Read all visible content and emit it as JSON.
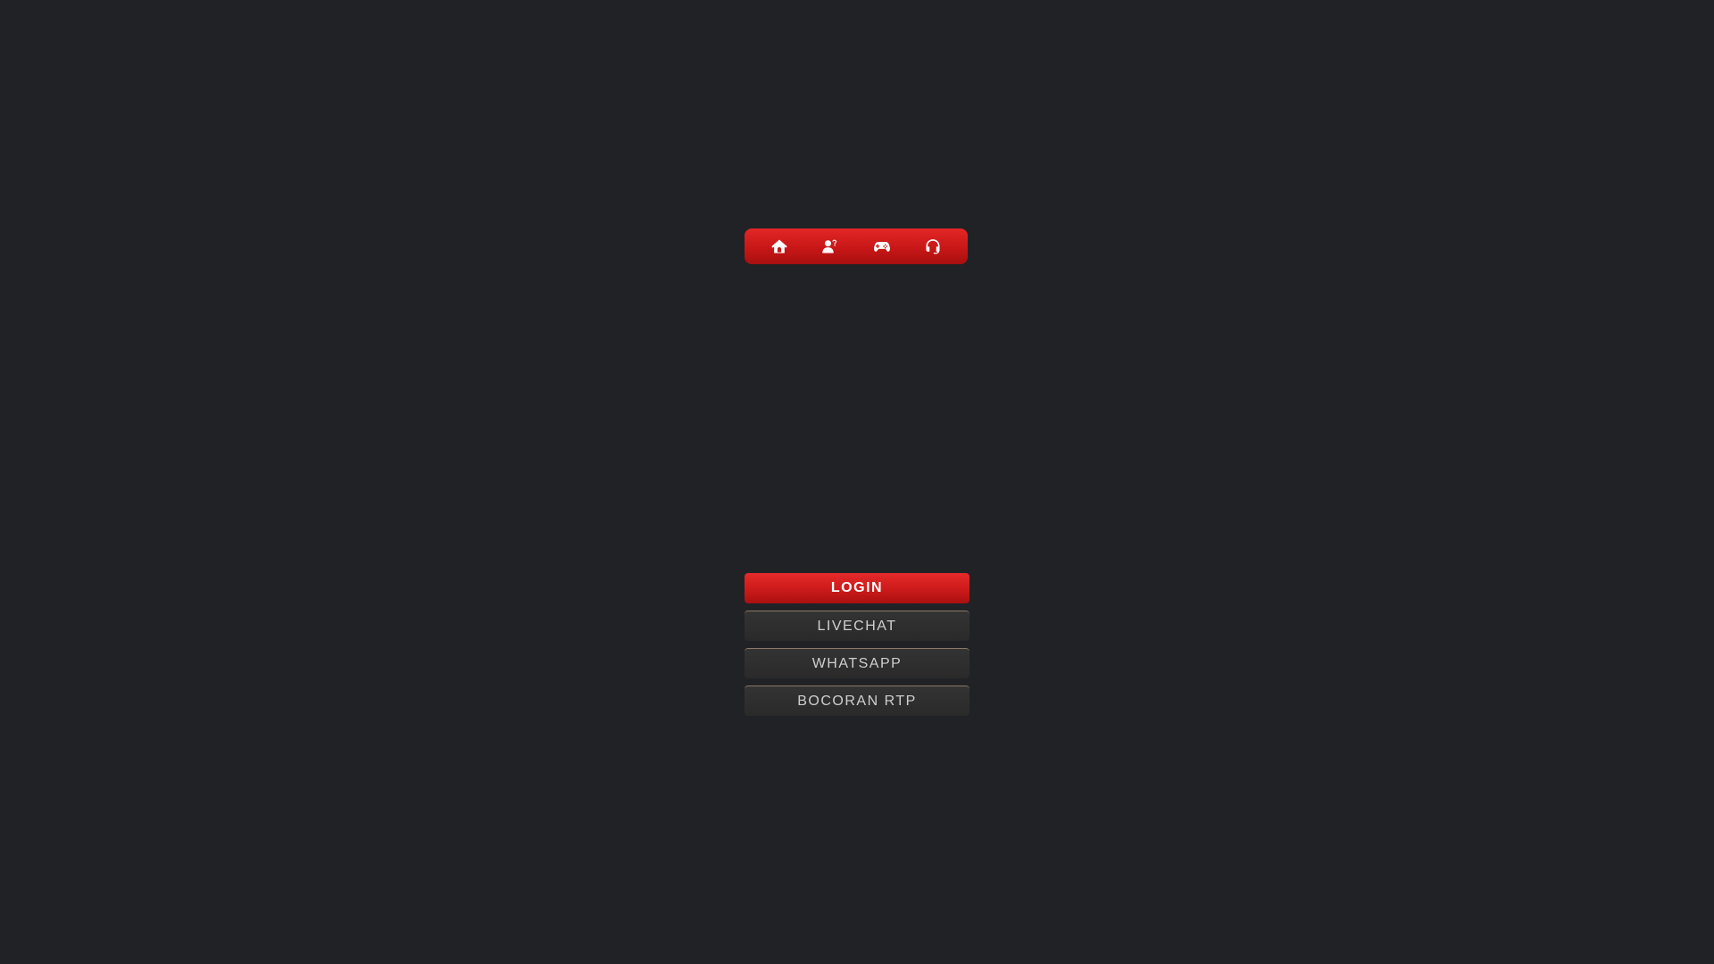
{
  "navbar": {
    "items": [
      {
        "icon": "home-icon",
        "title": "Home"
      },
      {
        "icon": "user-help-icon",
        "title": "Account Help"
      },
      {
        "icon": "gamepad-icon",
        "title": "Games"
      },
      {
        "icon": "headset-icon",
        "title": "Support"
      }
    ],
    "accent_color": "#d11c1c"
  },
  "buttons": {
    "login": "LOGIN",
    "livechat": "LIVECHAT",
    "whatsapp": "WHATSAPP",
    "bocoran_rtp": "BOCORAN RTP"
  },
  "colors": {
    "background": "#212226",
    "primary": "#d11c1c",
    "secondary": "#2e2e2e",
    "secondary_text": "#cfcfcf"
  }
}
